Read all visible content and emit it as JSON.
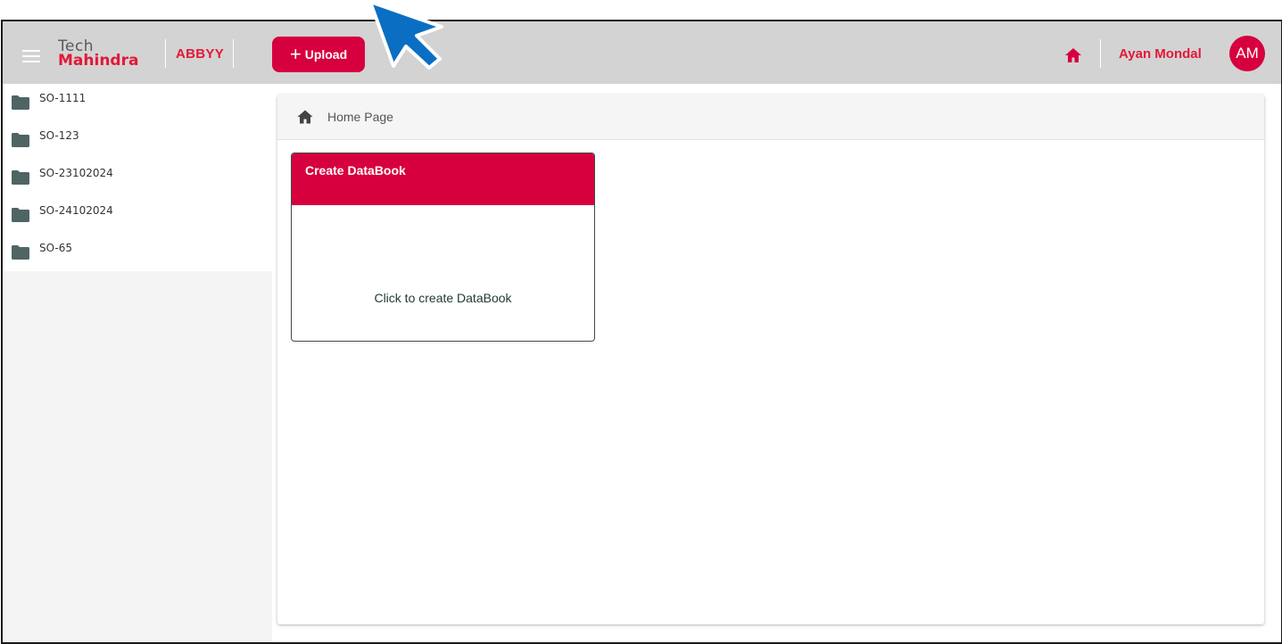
{
  "header": {
    "logo_line1": "Tech",
    "logo_line2": "Mahindra",
    "product": "ABBYY",
    "upload_label": "Upload",
    "upload_icon": "+",
    "user_name": "Ayan Mondal",
    "avatar_initials": "AM"
  },
  "sidebar": {
    "items": [
      {
        "label": "SO-1111"
      },
      {
        "label": "SO-123"
      },
      {
        "label": "SO-23102024"
      },
      {
        "label": "SO-24102024"
      },
      {
        "label": "SO-65"
      }
    ]
  },
  "breadcrumb": {
    "label": "Home Page"
  },
  "card": {
    "title": "Create DataBook",
    "body": "Click to create DataBook"
  },
  "colors": {
    "brand": "#d7003f",
    "logo_red": "#e31837",
    "topbar": "#d3d3d3",
    "folder": "#4f6563",
    "cursor": "#0a6fc2"
  },
  "icons": {
    "menu": "hamburger-icon",
    "home": "home-icon",
    "folder": "folder-icon",
    "pointer": "pointer-arrow-icon"
  }
}
